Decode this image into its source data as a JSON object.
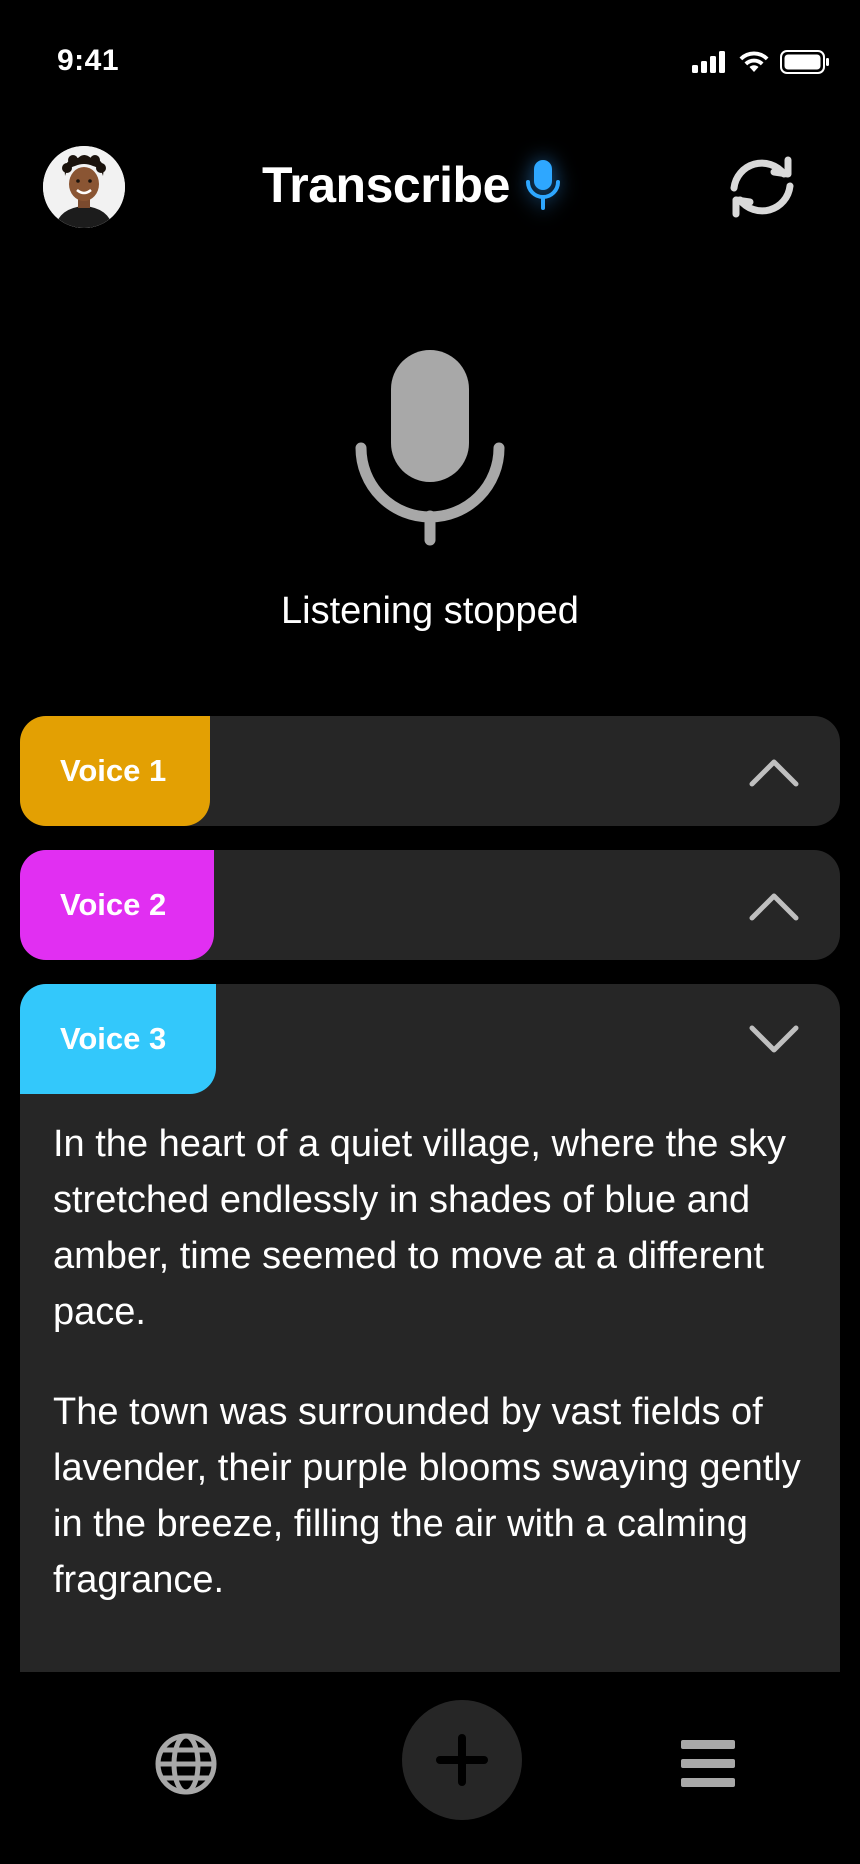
{
  "status_bar": {
    "time": "9:41",
    "icons": [
      "cellular-signal-icon",
      "wifi-icon",
      "battery-icon"
    ]
  },
  "header": {
    "title": "Transcribe",
    "title_icon": "microphone-icon",
    "avatar": "user-avatar",
    "action_icon": "refresh-icon",
    "accent_color": "#2ea7ff"
  },
  "recorder": {
    "icon": "microphone-icon",
    "status_text": "Listening stopped"
  },
  "voices": [
    {
      "label": "Voice 1",
      "color": "#e3a003",
      "expanded": false,
      "chevron": "chevron-up-icon"
    },
    {
      "label": "Voice 2",
      "color": "#e12ff2",
      "expanded": false,
      "chevron": "chevron-up-icon"
    },
    {
      "label": "Voice 3",
      "color": "#33c8fb",
      "expanded": true,
      "chevron": "chevron-down-icon",
      "paragraphs": [
        "In the heart of a quiet village, where the sky stretched endlessly in shades of blue and amber, time seemed to move at a different pace.",
        "The town was surrounded by vast fields of lavender, their purple blooms swaying gently in the breeze, filling the air with a calming fragrance."
      ]
    }
  ],
  "bottom_nav": {
    "left_icon": "globe-icon",
    "center_icon": "plus-icon",
    "right_icon": "menu-icon"
  }
}
